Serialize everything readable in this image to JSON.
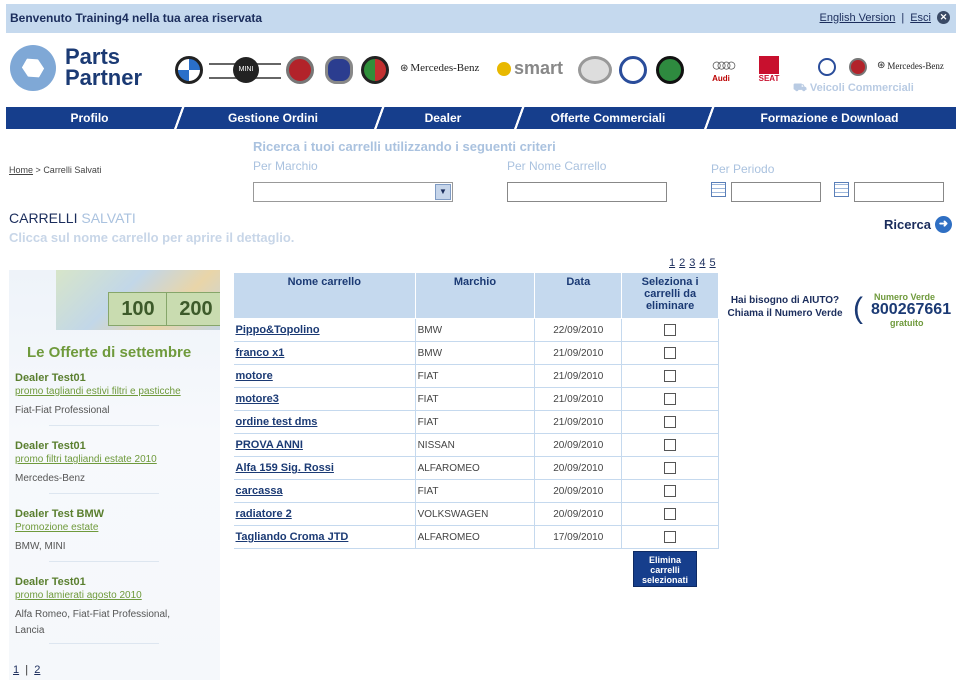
{
  "topbar": {
    "welcome": "Benvenuto Training4 nella tua area riservata",
    "english_link": "English Version",
    "separator": "|",
    "logout_link": "Esci"
  },
  "logo": {
    "line1": "Parts",
    "line2": "Partner"
  },
  "brands": [
    "BMW",
    "MINI",
    "FIAT",
    "LANCIA",
    "ALFA ROMEO",
    "Mercedes-Benz",
    "smart",
    "NISSAN",
    "Volkswagen",
    "SKODA",
    "Audi",
    "SEAT",
    "Veicoli Commerciali",
    "Fiat",
    "Mercedes-Benz"
  ],
  "veicoli_commerciali": "Veicoli Commerciali",
  "nav": [
    "Profilo",
    "Gestione Ordini",
    "Dealer",
    "Offerte Commerciali",
    "Formazione e Download"
  ],
  "breadcrumb": {
    "home": "Home",
    "sep": ">",
    "current": "Carrelli Salvati"
  },
  "search": {
    "title": "Ricerca i tuoi carrelli utilizzando i seguenti criteri",
    "by_brand": "Per Marchio",
    "by_name": "Per Nome Carrello",
    "by_period": "Per Periodo",
    "button": "Ricerca"
  },
  "page": {
    "title_strong": "CARRELLI",
    "title_light": "SALVATI",
    "subtitle": "Clicca sul nome carrello per aprire il dettaglio."
  },
  "offers": {
    "title": "Le Offerte di settembre",
    "image_bills": [
      "100",
      "200"
    ],
    "items": [
      {
        "dealer": "Dealer Test01",
        "link": "promo tagliandi estivi filtri e pasticche",
        "brands": "Fiat-Fiat Professional"
      },
      {
        "dealer": "Dealer Test01",
        "link": "promo filtri tagliandi estate 2010",
        "brands": "Mercedes-Benz"
      },
      {
        "dealer": "Dealer Test BMW",
        "link": "Promozione estate",
        "brands": "BMW, MINI"
      },
      {
        "dealer": "Dealer Test01",
        "link": "promo lamierati agosto 2010",
        "brands": "Alfa Romeo, Fiat-Fiat Professional, Lancia"
      }
    ],
    "pages": [
      "1",
      "2"
    ],
    "pages_sep": "|"
  },
  "table": {
    "pages": [
      "1",
      "2",
      "3",
      "4",
      "5"
    ],
    "headers": [
      "Nome carrello",
      "Marchio",
      "Data",
      "Seleziona i carrelli da eliminare"
    ],
    "rows": [
      {
        "name": "Pippo&Topolino",
        "brand": "BMW",
        "date": "22/09/2010"
      },
      {
        "name": "franco x1",
        "brand": "BMW",
        "date": "21/09/2010"
      },
      {
        "name": "motore",
        "brand": "FIAT",
        "date": "21/09/2010"
      },
      {
        "name": "motore3",
        "brand": "FIAT",
        "date": "21/09/2010"
      },
      {
        "name": "ordine test dms",
        "brand": "FIAT",
        "date": "21/09/2010"
      },
      {
        "name": "PROVA ANNI",
        "brand": "NISSAN",
        "date": "20/09/2010"
      },
      {
        "name": "Alfa 159 Sig. Rossi",
        "brand": "ALFAROMEO",
        "date": "20/09/2010"
      },
      {
        "name": "carcassa",
        "brand": "FIAT",
        "date": "20/09/2010"
      },
      {
        "name": "radiatore 2",
        "brand": "VOLKSWAGEN",
        "date": "20/09/2010"
      },
      {
        "name": "Tagliando Croma JTD",
        "brand": "ALFAROMEO",
        "date": "17/09/2010"
      }
    ],
    "delete_button": "Elimina carrelli selezionati"
  },
  "help": {
    "line1": "Hai bisogno di AIUTO?",
    "line2": "Chiama il Numero Verde",
    "badge_top": "Numero Verde",
    "number": "800267661",
    "badge_bottom": "gratuito"
  }
}
